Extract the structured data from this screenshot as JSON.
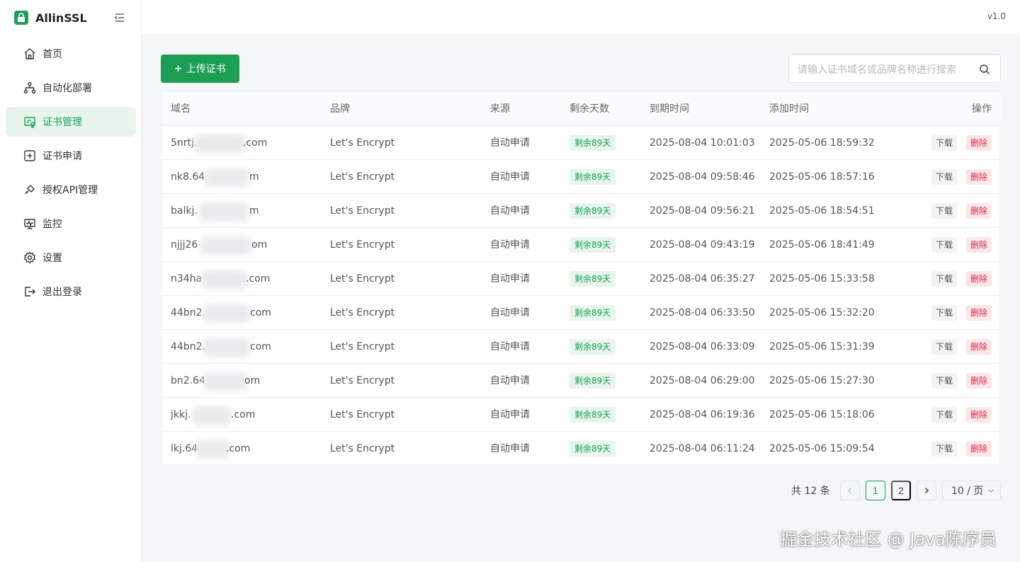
{
  "app": {
    "name": "AllinSSL",
    "version": "v1.0"
  },
  "sidebar": {
    "items": [
      {
        "label": "首页",
        "icon": "home-icon"
      },
      {
        "label": "自动化部署",
        "icon": "workflow-icon"
      },
      {
        "label": "证书管理",
        "icon": "certificate-icon",
        "active": true
      },
      {
        "label": "证书申请",
        "icon": "plus-square-icon"
      },
      {
        "label": "授权API管理",
        "icon": "api-key-icon"
      },
      {
        "label": "监控",
        "icon": "monitor-icon"
      },
      {
        "label": "设置",
        "icon": "gear-icon"
      },
      {
        "label": "退出登录",
        "icon": "logout-icon"
      }
    ]
  },
  "toolbar": {
    "upload_label": "上传证书",
    "search_placeholder": "请输入证书域名或品牌名称进行搜索"
  },
  "table": {
    "columns": [
      "域名",
      "品牌",
      "来源",
      "剩余天数",
      "到期时间",
      "添加时间",
      "操作"
    ],
    "rows": [
      {
        "domain_prefix": "5nrtj.",
        "domain_suffix": ".com",
        "brand": "Let's Encrypt",
        "source": "自动申请",
        "remaining": "剩余89天",
        "expire": "2025-08-04 10:01:03",
        "added": "2025-05-06 18:59:32"
      },
      {
        "domain_prefix": "nk8.64",
        "domain_suffix": "m",
        "brand": "Let's Encrypt",
        "source": "自动申请",
        "remaining": "剩余89天",
        "expire": "2025-08-04 09:58:46",
        "added": "2025-05-06 18:57:16"
      },
      {
        "domain_prefix": "balkj.",
        "domain_suffix": "m",
        "brand": "Let's Encrypt",
        "source": "自动申请",
        "remaining": "剩余89天",
        "expire": "2025-08-04 09:56:21",
        "added": "2025-05-06 18:54:51"
      },
      {
        "domain_prefix": "njjj26",
        "domain_suffix": "om",
        "brand": "Let's Encrypt",
        "source": "自动申请",
        "remaining": "剩余89天",
        "expire": "2025-08-04 09:43:19",
        "added": "2025-05-06 18:41:49"
      },
      {
        "domain_prefix": "n34ha",
        "domain_suffix": ".com",
        "brand": "Let's Encrypt",
        "source": "自动申请",
        "remaining": "剩余89天",
        "expire": "2025-08-04 06:35:27",
        "added": "2025-05-06 15:33:58"
      },
      {
        "domain_prefix": "44bn2.",
        "domain_suffix": "com",
        "brand": "Let's Encrypt",
        "source": "自动申请",
        "remaining": "剩余89天",
        "expire": "2025-08-04 06:33:50",
        "added": "2025-05-06 15:32:20"
      },
      {
        "domain_prefix": "44bn2.",
        "domain_suffix": "com",
        "brand": "Let's Encrypt",
        "source": "自动申请",
        "remaining": "剩余89天",
        "expire": "2025-08-04 06:33:09",
        "added": "2025-05-06 15:31:39"
      },
      {
        "domain_prefix": "bn2.64",
        "domain_suffix": "om",
        "brand": "Let's Encrypt",
        "source": "自动申请",
        "remaining": "剩余89天",
        "expire": "2025-08-04 06:29:00",
        "added": "2025-05-06 15:27:30"
      },
      {
        "domain_prefix": "jkkj.",
        "domain_suffix": ".com",
        "brand": "Let's Encrypt",
        "source": "自动申请",
        "remaining": "剩余89天",
        "expire": "2025-08-04 06:19:36",
        "added": "2025-05-06 15:18:06"
      },
      {
        "domain_prefix": "lkj.64",
        "domain_suffix": ".com",
        "brand": "Let's Encrypt",
        "source": "自动申请",
        "remaining": "剩余89天",
        "expire": "2025-08-04 06:11:24",
        "added": "2025-05-06 15:09:54"
      }
    ],
    "actions": {
      "download": "下载",
      "delete": "删除"
    }
  },
  "pagination": {
    "total": "共 12 条",
    "pages": [
      "1",
      "2"
    ],
    "current": "1",
    "page_size": "10 / 页"
  },
  "watermark": "掘金技术社区 @ Java陈序员",
  "colors": {
    "primary": "#18a058",
    "danger": "#d03050"
  }
}
